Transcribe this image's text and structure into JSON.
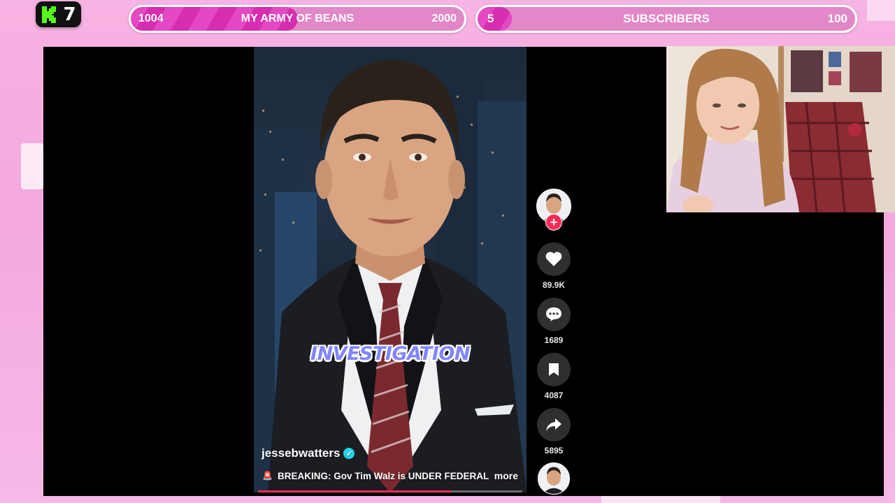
{
  "badge": {
    "platform_icon": "kick-logo-icon",
    "value": "7"
  },
  "goal_army": {
    "current": "1004",
    "label": "MY ARMY OF BEANS",
    "target": "2000",
    "progress": 0.502
  },
  "goal_subs": {
    "current": "5",
    "label": "SUBSCRIBERS",
    "target": "100",
    "progress": 0.05
  },
  "video": {
    "caption": "INVESTIGATION",
    "username": "jessebwatters",
    "description": "BREAKING: Gov Tim Walz is UNDER FEDERAL",
    "more_label": "more",
    "playback_progress": 0.73
  },
  "actions": {
    "likes": "89.9K",
    "comments": "1689",
    "saves": "4087",
    "shares": "5895"
  },
  "colors": {
    "accent_pink": "#e548c4",
    "tiktok_red": "#fe2c55",
    "verified_blue": "#20d5ec",
    "caption_purple": "#7f86ff"
  }
}
